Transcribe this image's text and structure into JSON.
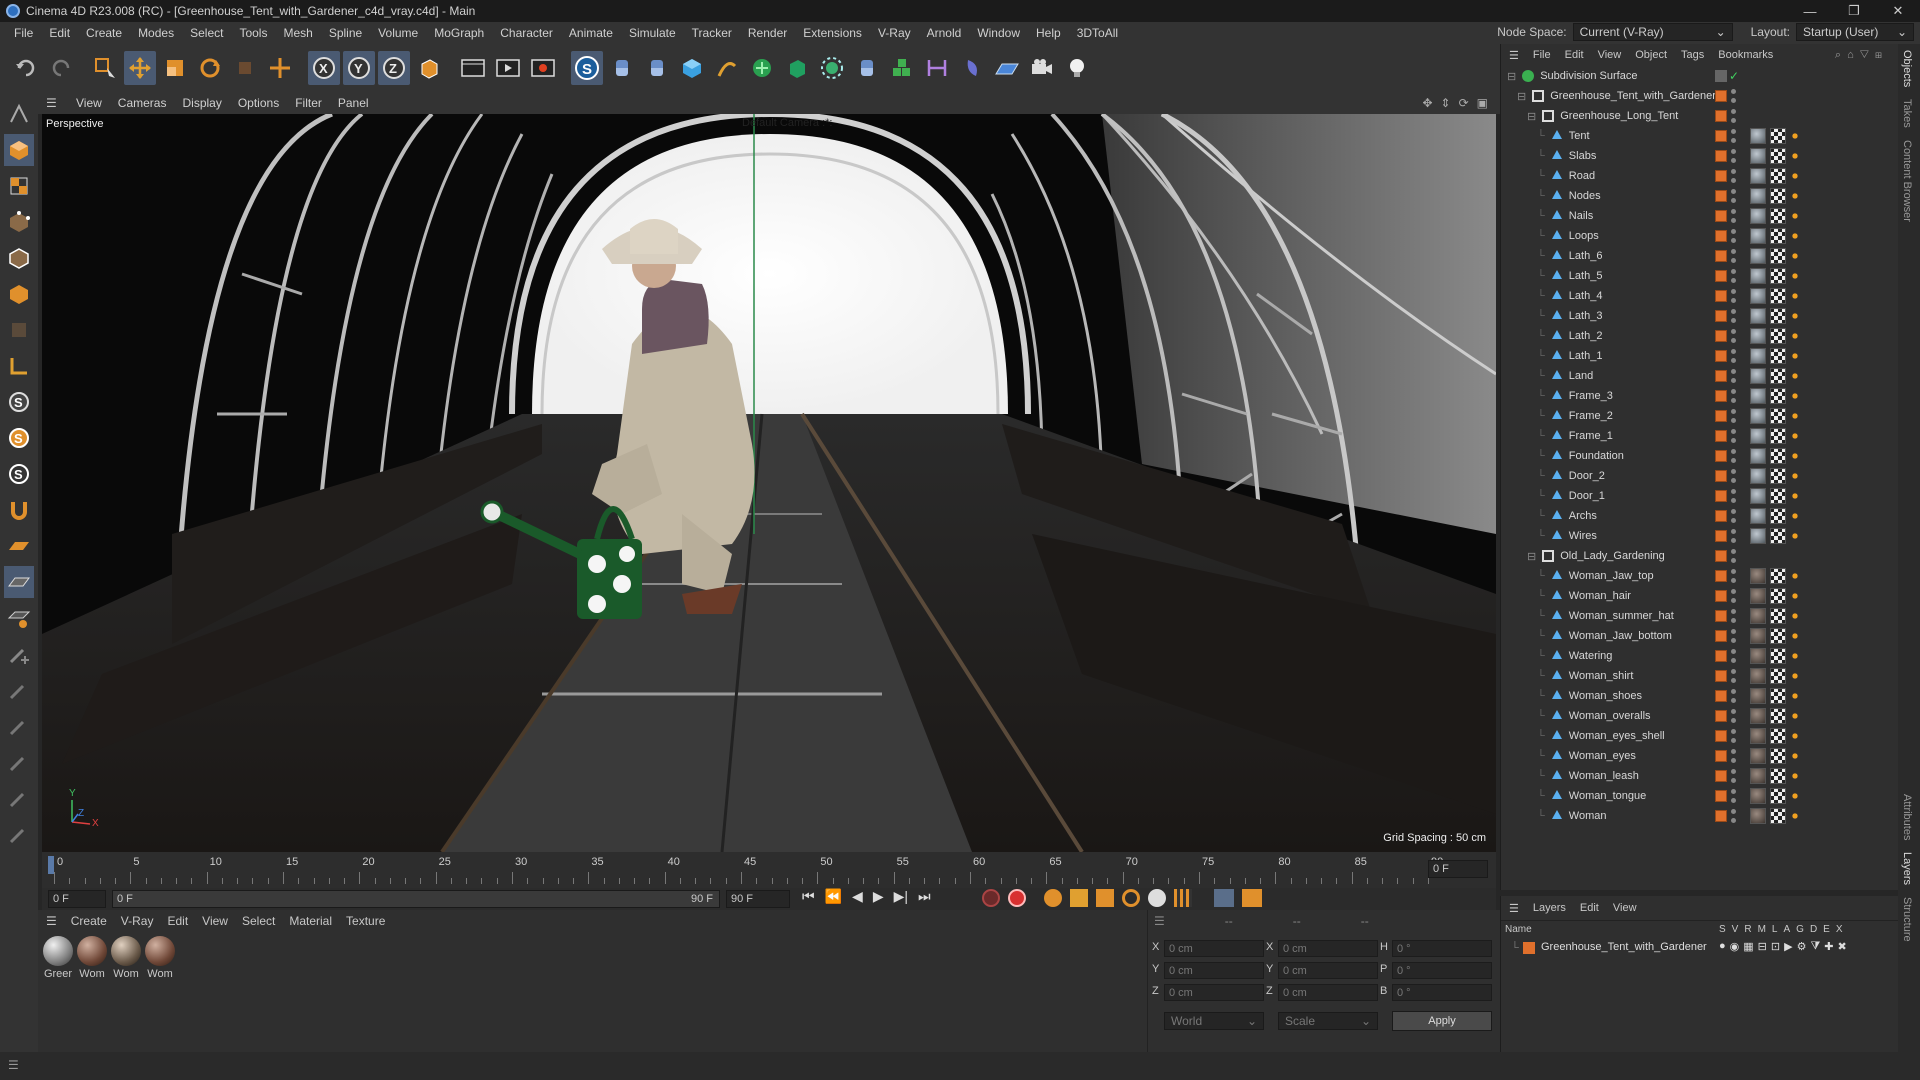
{
  "window": {
    "title": "Cinema 4D R23.008 (RC) - [Greenhouse_Tent_with_Gardener_c4d_vray.c4d] - Main",
    "btns": [
      "—",
      "❐",
      "✕"
    ]
  },
  "menubar": {
    "items": [
      "File",
      "Edit",
      "Create",
      "Modes",
      "Select",
      "Tools",
      "Mesh",
      "Spline",
      "Volume",
      "MoGraph",
      "Character",
      "Animate",
      "Simulate",
      "Tracker",
      "Render",
      "Extensions",
      "V-Ray",
      "Arnold",
      "Window",
      "Help",
      "3DToAll"
    ],
    "node_space_label": "Node Space:",
    "node_space_value": "Current (V-Ray)",
    "layout_label": "Layout:",
    "layout_value": "Startup (User)"
  },
  "viewport": {
    "menu": [
      "View",
      "Cameras",
      "Display",
      "Options",
      "Filter",
      "Panel"
    ],
    "label": "Perspective",
    "camera": "Default Camera :*:",
    "grid_spacing": "Grid Spacing : 50 cm",
    "axis_y": "Y",
    "axis_z": "Z",
    "axis_x": "X"
  },
  "timeline": {
    "ticks": [
      "0",
      "5",
      "10",
      "15",
      "20",
      "25",
      "30",
      "35",
      "40",
      "45",
      "50",
      "55",
      "60",
      "65",
      "70",
      "75",
      "80",
      "85",
      "90"
    ],
    "current_frame": "0 F"
  },
  "controls": {
    "start": "0 F",
    "current": "0 F",
    "end_a": "90 F",
    "end_b": "90 F"
  },
  "material_manager": {
    "menu": [
      "Create",
      "V-Ray",
      "Edit",
      "View",
      "Select",
      "Material",
      "Texture"
    ],
    "materials": [
      "Greer",
      "Wom",
      "Wom",
      "Wom"
    ]
  },
  "coords": {
    "x_pos": "0 cm",
    "y_pos": "0 cm",
    "z_pos": "0 cm",
    "x_size": "0 cm",
    "y_size": "0 cm",
    "z_size": "0 cm",
    "h_rot": "0 °",
    "p_rot": "0 °",
    "b_rot": "0 °",
    "labels": [
      "X",
      "Y",
      "Z",
      "X",
      "Y",
      "Z",
      "H",
      "P",
      "B"
    ],
    "dashes": [
      "--",
      "--",
      "--"
    ],
    "world": "World",
    "scale": "Scale",
    "apply": "Apply"
  },
  "object_manager": {
    "menu": [
      "File",
      "Edit",
      "View",
      "Object",
      "Tags",
      "Bookmarks"
    ],
    "root": "Subdivision Surface",
    "group1": "Greenhouse_Tent_with_Gardener",
    "group2": "Greenhouse_Long_Tent",
    "tent_objects": [
      "Tent",
      "Slabs",
      "Road",
      "Nodes",
      "Nails",
      "Loops",
      "Lath_6",
      "Lath_5",
      "Lath_4",
      "Lath_3",
      "Lath_2",
      "Lath_1",
      "Land",
      "Frame_3",
      "Frame_2",
      "Frame_1",
      "Foundation",
      "Door_2",
      "Door_1",
      "Archs",
      "Wires"
    ],
    "group3": "Old_Lady_Gardening",
    "lady_objects": [
      "Woman_Jaw_top",
      "Woman_hair",
      "Woman_summer_hat",
      "Woman_Jaw_bottom",
      "Watering",
      "Woman_shirt",
      "Woman_shoes",
      "Woman_overalls",
      "Woman_eyes_shell",
      "Woman_eyes",
      "Woman_leash",
      "Woman_tongue",
      "Woman"
    ]
  },
  "layers": {
    "menu": [
      "Layers",
      "Edit",
      "View"
    ],
    "col_name": "Name",
    "cols": [
      "S",
      "V",
      "R",
      "M",
      "L",
      "A",
      "G",
      "D",
      "E",
      "X"
    ],
    "layer_name": "Greenhouse_Tent_with_Gardener"
  },
  "right_tabs": [
    "Objects",
    "Takes",
    "Content Browser",
    "Attributes",
    "Layers",
    "Structure"
  ],
  "colors": {
    "accent": "#e0702c",
    "active_tool": "#4a5a72"
  }
}
